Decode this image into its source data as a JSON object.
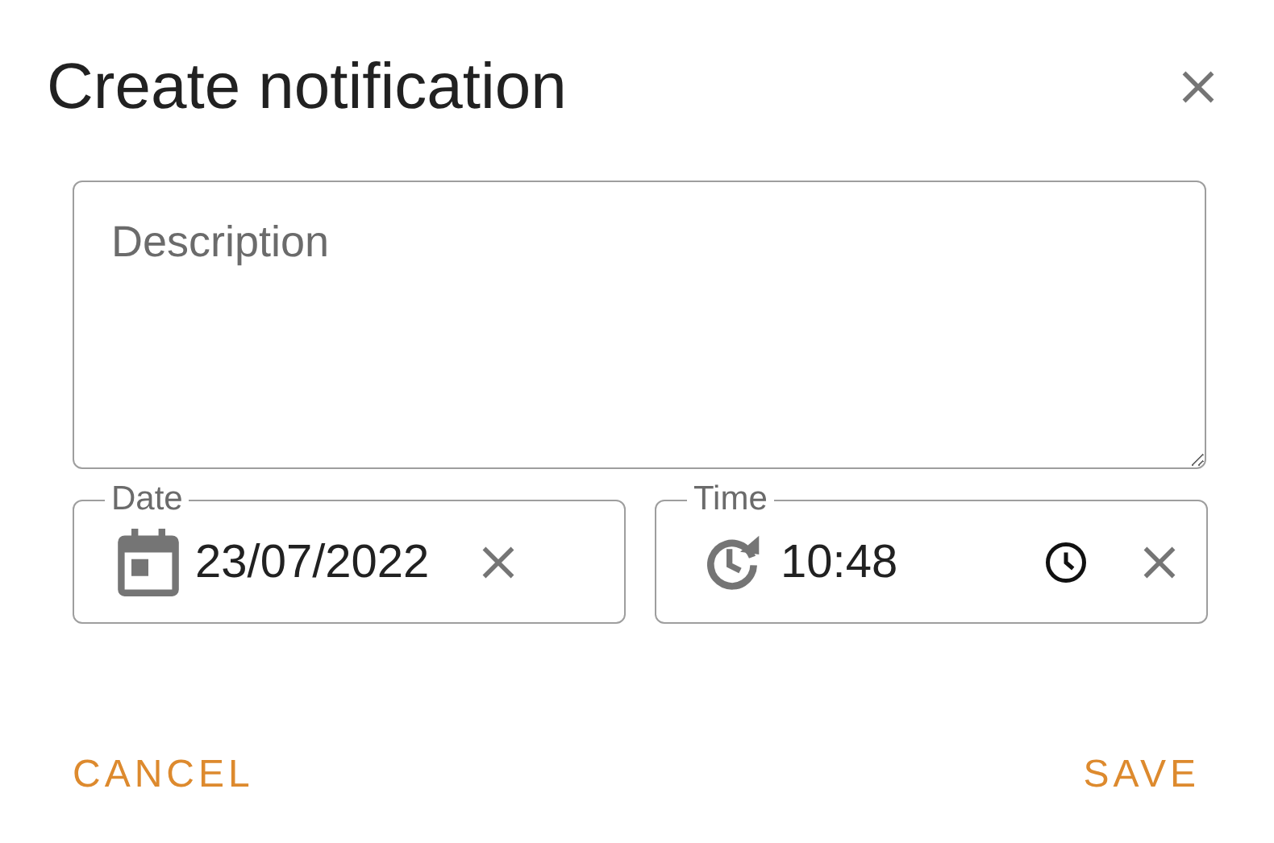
{
  "dialog": {
    "title": "Create notification"
  },
  "description": {
    "placeholder": "Description"
  },
  "date": {
    "label": "Date",
    "value": "23/07/2022"
  },
  "time": {
    "label": "Time",
    "value": "10:48"
  },
  "buttons": [
    {
      "kind": "cancel",
      "label": "CANCEL"
    },
    {
      "kind": "save",
      "label": "SAVE"
    }
  ]
}
